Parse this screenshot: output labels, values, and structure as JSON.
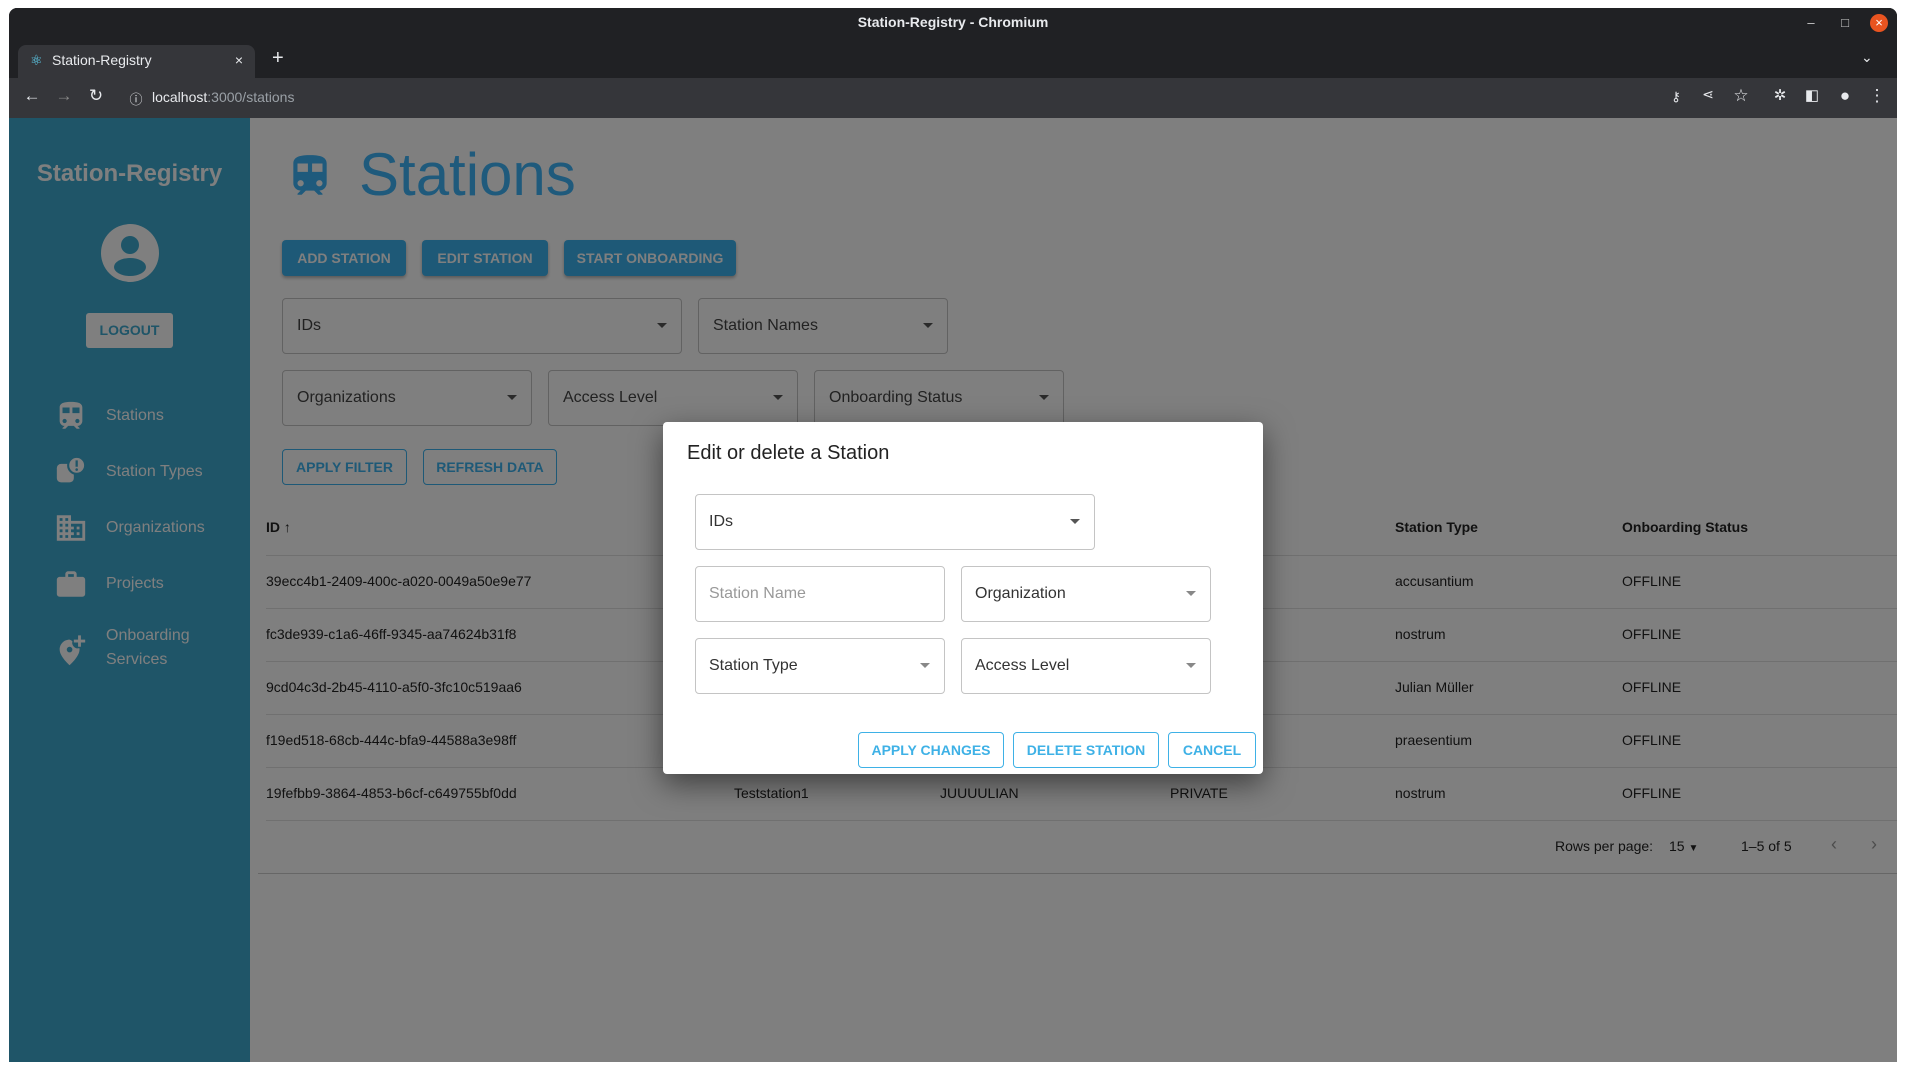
{
  "browser": {
    "window_title": "Station-Registry - Chromium",
    "tab_title": "Station-Registry",
    "url_host": "localhost",
    "url_rest": ":3000/stations"
  },
  "sidebar": {
    "app_title": "Station-Registry",
    "logout_label": "LOGOUT",
    "items": [
      {
        "label": "Stations",
        "icon": "train-icon"
      },
      {
        "label": "Station Types",
        "icon": "station-type-icon"
      },
      {
        "label": "Organizations",
        "icon": "building-icon"
      },
      {
        "label": "Projects",
        "icon": "briefcase-icon"
      },
      {
        "label": "Onboarding Services",
        "icon": "add-location-icon"
      }
    ]
  },
  "header": {
    "title": "Stations"
  },
  "toolbar": {
    "add": "ADD STATION",
    "edit": "EDIT STATION",
    "onboard": "START ONBOARDING"
  },
  "filters": {
    "ids": "IDs",
    "names": "Station Names",
    "orgs": "Organizations",
    "access": "Access Level",
    "onboarding": "Onboarding Status",
    "apply": "APPLY FILTER",
    "refresh": "REFRESH DATA"
  },
  "table": {
    "headers": {
      "id": "ID",
      "type": "Station Type",
      "status": "Onboarding Status"
    },
    "rows": [
      {
        "id": "39ecc4b1-2409-400c-a020-0049a50e9e77",
        "type": "accusantium",
        "status": "OFFLINE"
      },
      {
        "id": "fc3de939-c1a6-46ff-9345-aa74624b31f8",
        "type": "nostrum",
        "status": "OFFLINE"
      },
      {
        "id": "9cd04c3d-2b45-4110-a5f0-3fc10c519aa6",
        "type": "Julian Müller",
        "status": "OFFLINE"
      },
      {
        "id": "f19ed518-68cb-444c-bfa9-44588a3e98ff",
        "type": "praesentium",
        "status": "OFFLINE"
      },
      {
        "id": "19fefbb9-3864-4853-b6cf-c649755bf0dd",
        "name": "Teststation1",
        "org": "JUUUULIAN",
        "access": "PRIVATE",
        "type": "nostrum",
        "status": "OFFLINE"
      }
    ],
    "pagination": {
      "rows_per_page_label": "Rows per page:",
      "rows_per_page": "15",
      "range": "1–5 of 5"
    }
  },
  "modal": {
    "title": "Edit or delete a Station",
    "ids": "IDs",
    "name_placeholder": "Station Name",
    "organization": "Organization",
    "station_type": "Station Type",
    "access_level": "Access Level",
    "apply": "APPLY CHANGES",
    "delete": "DELETE STATION",
    "cancel": "CANCEL"
  },
  "colors": {
    "sidebar": "#3eaad0",
    "primary": "#3db3ee",
    "modal_button": "#3eb1e6"
  }
}
